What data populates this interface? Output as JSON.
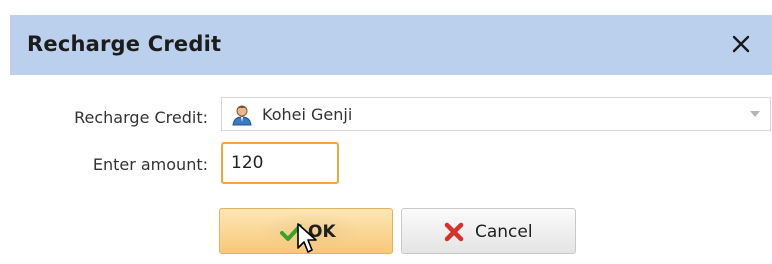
{
  "dialog": {
    "title": "Recharge Credit",
    "close_icon": "close-icon"
  },
  "form": {
    "recharge_label": "Recharge Credit:",
    "user_icon": "user-icon",
    "selected_user": "Kohei Genji",
    "dropdown_icon": "chevron-down-icon",
    "amount_label": "Enter amount:",
    "amount_value": "120"
  },
  "buttons": {
    "ok_label": "OK",
    "ok_icon": "check-icon",
    "cancel_label": "Cancel",
    "cancel_icon": "x-icon"
  },
  "colors": {
    "titlebar": "#bad0ed",
    "ok_button": "#f8c877",
    "focus_border": "#f0a838",
    "check_green": "#3aa12a",
    "cancel_red": "#d9302a"
  }
}
